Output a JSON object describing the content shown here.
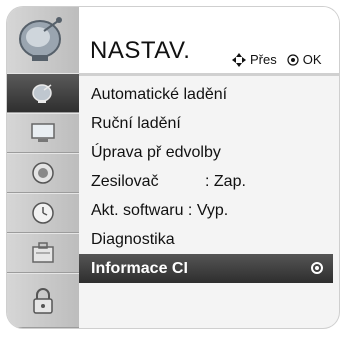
{
  "header": {
    "title": "NASTAV.",
    "move_hint": "Přes",
    "ok_hint": "OK"
  },
  "sidebar": {
    "items": [
      {
        "icon": "satellite-dish-icon",
        "active": true
      },
      {
        "icon": "monitor-icon",
        "active": false
      },
      {
        "icon": "speaker-icon",
        "active": false
      },
      {
        "icon": "clock-icon",
        "active": false
      },
      {
        "icon": "lock-box-icon",
        "active": false
      },
      {
        "icon": "padlock-icon",
        "active": false
      }
    ]
  },
  "menu": {
    "items": [
      {
        "label": "Automatické ladění",
        "value": ""
      },
      {
        "label": "Ruční ladění",
        "value": ""
      },
      {
        "label": "Úprava př edvolby",
        "value": ""
      },
      {
        "label": "Zesilovač",
        "value": ": Zap."
      },
      {
        "label": "Akt. softwaru : Vyp.",
        "value": ""
      },
      {
        "label": "Diagnostika",
        "value": ""
      },
      {
        "label": "Informace CI",
        "value": "",
        "selected": true
      }
    ]
  },
  "colors": {
    "selected_bg": "#3a3a3a",
    "sidebar_bg": "#c8c8c8",
    "panel_bg": "#f4f4f4"
  }
}
